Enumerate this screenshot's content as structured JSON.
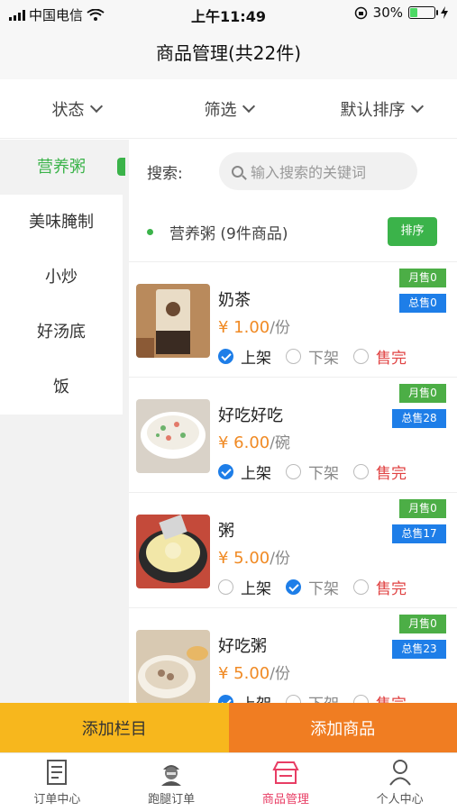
{
  "statusbar": {
    "carrier": "中国电信",
    "time": "上午11:49",
    "battery": "30%",
    "battery_level": 0.3
  },
  "title": "商品管理(共22件)",
  "filters": [
    {
      "label": "状态"
    },
    {
      "label": "筛选"
    },
    {
      "label": "默认排序"
    }
  ],
  "sidebar": {
    "items": [
      {
        "label": "营养粥",
        "active": true
      },
      {
        "label": "美味腌制"
      },
      {
        "label": "小炒"
      },
      {
        "label": "好汤底"
      },
      {
        "label": "饭"
      }
    ]
  },
  "search": {
    "label": "搜索:",
    "placeholder": "输入搜索的关键词"
  },
  "category": {
    "title": "营养粥 (9件商品)",
    "sort_button": "排序"
  },
  "products": [
    {
      "name": "奶茶",
      "price": "¥ 1.00",
      "unit": "/份",
      "monthly": "月售0",
      "total": "总售0",
      "status": "上架"
    },
    {
      "name": "好吃好吃",
      "price": "¥ 6.00",
      "unit": "/碗",
      "monthly": "月售0",
      "total": "总售28",
      "status": "上架"
    },
    {
      "name": "粥",
      "price": "¥ 5.00",
      "unit": "/份",
      "monthly": "月售0",
      "total": "总售17",
      "status": "下架"
    },
    {
      "name": "好吃粥",
      "price": "¥ 5.00",
      "unit": "/份",
      "monthly": "月售0",
      "total": "总售23",
      "status": "上架"
    }
  ],
  "status_options": {
    "on": "上架",
    "off": "下架",
    "sold_out": "售完"
  },
  "buttons": {
    "add_column": "添加栏目",
    "add_product": "添加商品"
  },
  "tabbar": [
    {
      "label": "订单中心",
      "icon": "document-icon"
    },
    {
      "label": "跑腿订单",
      "icon": "courier-icon"
    },
    {
      "label": "商品管理",
      "icon": "store-icon",
      "active": true
    },
    {
      "label": "个人中心",
      "icon": "person-icon"
    }
  ],
  "colors": {
    "accent_green": "#3bb34a",
    "price_orange": "#f08a24",
    "active_tab": "#e83d64",
    "blue": "#1e7ee8"
  }
}
